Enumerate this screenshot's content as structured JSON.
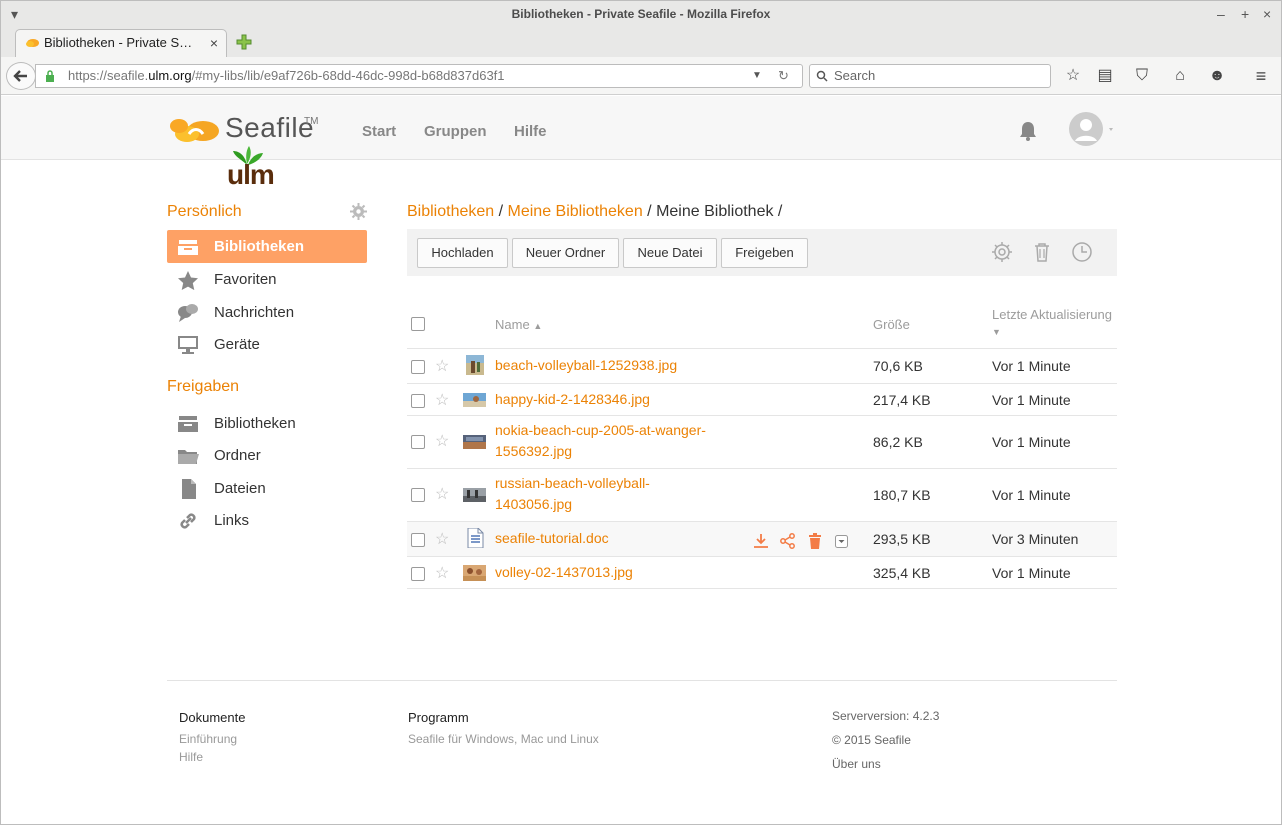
{
  "browser": {
    "window_title": "Bibliotheken - Private Seafile - Mozilla Firefox",
    "tab_title": "Bibliotheken - Private S…",
    "url_prefix": "https://seafile.",
    "url_host": "ulm.org",
    "url_suffix": "/#my-libs/lib/e9af726b-68dd-46dc-998d-b68d837d63f1",
    "search_placeholder": "Search"
  },
  "header": {
    "logo": "Seafile",
    "logo_tm": "TM",
    "org_logo": "ulm",
    "nav": [
      "Start",
      "Gruppen",
      "Hilfe"
    ]
  },
  "sidebar": {
    "personal_heading": "Persönlich",
    "personal_items": [
      {
        "label": "Bibliotheken",
        "icon": "library-icon",
        "active": true
      },
      {
        "label": "Favoriten",
        "icon": "star-icon"
      },
      {
        "label": "Nachrichten",
        "icon": "chat-icon"
      },
      {
        "label": "Geräte",
        "icon": "monitor-icon"
      }
    ],
    "shared_heading": "Freigaben",
    "shared_items": [
      {
        "label": "Bibliotheken",
        "icon": "library-icon"
      },
      {
        "label": "Ordner",
        "icon": "folder-icon"
      },
      {
        "label": "Dateien",
        "icon": "file-icon"
      },
      {
        "label": "Links",
        "icon": "link-icon"
      }
    ]
  },
  "breadcrumb": {
    "libs": "Bibliotheken",
    "sep1": " / ",
    "mylibs": "Meine Bibliotheken",
    "sep2": " / ",
    "current": "Meine Bibliothek",
    "sep3": " /"
  },
  "toolbar": {
    "upload": "Hochladen",
    "new_folder": "Neuer Ordner",
    "new_file": "Neue Datei",
    "share": "Freigeben"
  },
  "table": {
    "col_name": "Name",
    "col_size": "Größe",
    "col_updated": "Letzte Aktualisierung",
    "rows": [
      {
        "name": "beach-volleyball-1252938.jpg",
        "size": "70,6 KB",
        "updated": "Vor 1 Minute"
      },
      {
        "name": "happy-kid-2-1428346.jpg",
        "size": "217,4 KB",
        "updated": "Vor 1 Minute"
      },
      {
        "name": "nokia-beach-cup-2005-at-wanger-1556392.jpg",
        "name_l1": "nokia-beach-cup-2005-at-wanger-",
        "name_l2": "1556392.jpg",
        "size": "86,2 KB",
        "updated": "Vor 1 Minute"
      },
      {
        "name": "russian-beach-volleyball-1403056.jpg",
        "name_l1": "russian-beach-volleyball-",
        "name_l2": "1403056.jpg",
        "size": "180,7 KB",
        "updated": "Vor 1 Minute"
      },
      {
        "name": "seafile-tutorial.doc",
        "size": "293,5 KB",
        "updated": "Vor 3 Minuten"
      },
      {
        "name": "volley-02-1437013.jpg",
        "size": "325,4 KB",
        "updated": "Vor 1 Minute"
      }
    ]
  },
  "footer": {
    "docs_heading": "Dokumente",
    "docs_links": [
      "Einführung",
      "Hilfe"
    ],
    "program_heading": "Programm",
    "program_link": "Seafile für Windows, Mac und Linux",
    "server_version": "Serverversion: 4.2.3",
    "copyright": "© 2015 Seafile",
    "about": "Über uns"
  },
  "colors": {
    "accent": "#eb8205",
    "active_bg": "#fea165"
  }
}
